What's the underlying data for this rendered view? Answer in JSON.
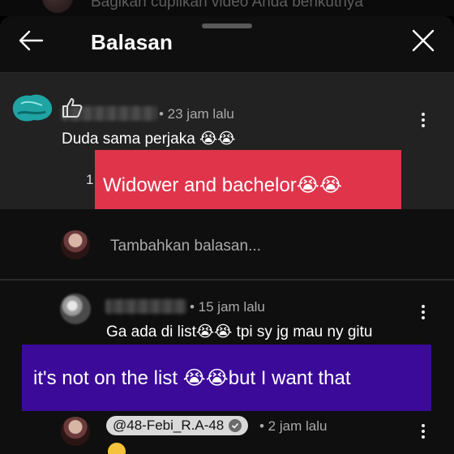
{
  "background_text": {
    "partial_caption": "Bagikan cuplikan video Anda berikutnya"
  },
  "header": {
    "title": "Balasan",
    "back_icon": "arrow-left-icon",
    "close_icon": "close-icon"
  },
  "comment": {
    "time": "• 23 jam lalu",
    "text": "Duda sama perjaka 😭😭",
    "like_count": "1"
  },
  "translation_overlays": {
    "first": "Widower and bachelor😭😭",
    "second": "it's not on the list 😭😭but I want that"
  },
  "reply_input": {
    "placeholder": "Tambahkan balasan..."
  },
  "replies": [
    {
      "time": "• 15 jam lalu",
      "text": "Ga ada di list😭😭 tpi sy jg mau ny gitu"
    },
    {
      "handle": "@48-Febi_R.A-48",
      "time": "• 2 jam lalu"
    }
  ],
  "colors": {
    "overlay_red": "#e0344b",
    "overlay_purple": "#3b0a99",
    "comment_bg": "#222222"
  }
}
